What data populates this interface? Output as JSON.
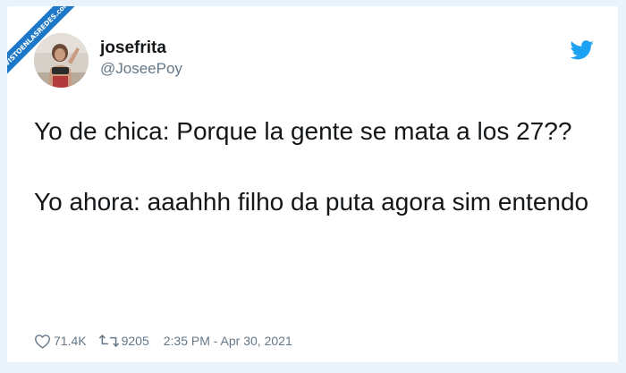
{
  "watermark": {
    "text": "VISTOENLASREDES",
    "suffix": ".com",
    "color": "#1d78c7"
  },
  "author": {
    "display_name": "josefrita",
    "handle": "@JoseePoy"
  },
  "tweet": {
    "paragraphs": [
      "Yo de chica: Porque la gente se mata a los 27??",
      "Yo ahora: aaahhh filho da puta agora sim entendo"
    ]
  },
  "stats": {
    "likes": "71.4K",
    "retweets": "9205",
    "timestamp": "2:35 PM - Apr 30, 2021"
  },
  "icons": {
    "brand": "twitter-bird-icon",
    "like": "heart-icon",
    "retweet": "retweet-icon"
  },
  "colors": {
    "background": "#e8f3fb",
    "card": "#ffffff",
    "twitter_blue": "#1da1f2",
    "text": "#14171a",
    "muted": "#657786"
  }
}
